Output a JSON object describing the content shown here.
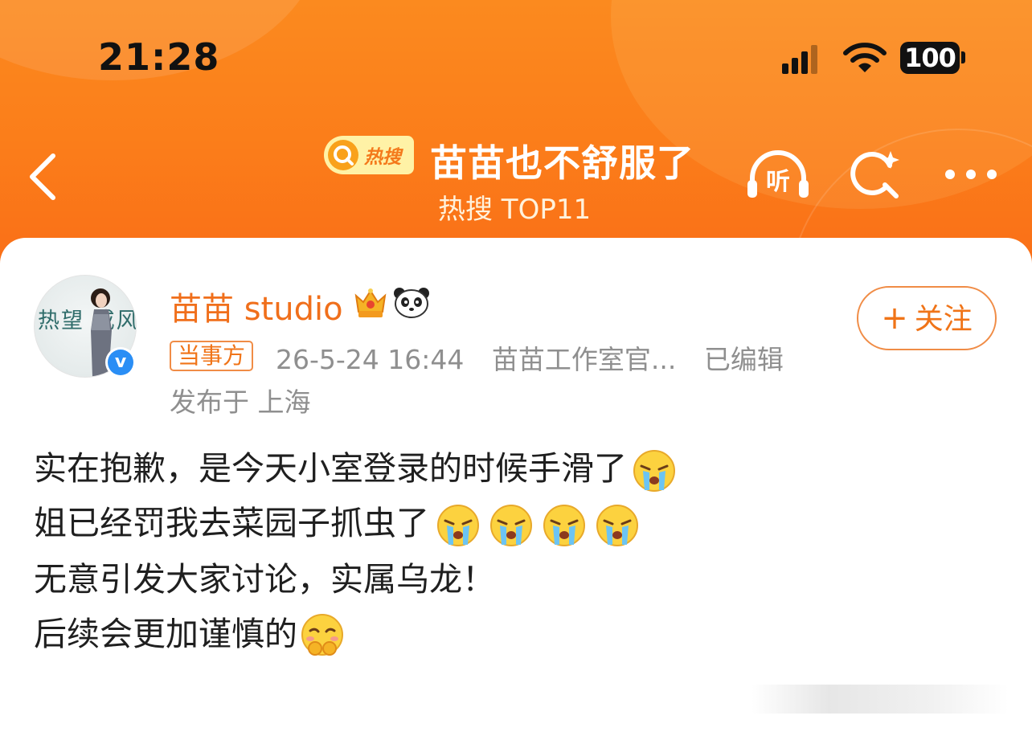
{
  "status_bar": {
    "time": "21:28",
    "battery": "100",
    "icons": [
      "signal-icon",
      "wifi-icon",
      "battery-icon"
    ]
  },
  "header": {
    "back_icon": "chevron-left-icon",
    "badge_label": "热搜",
    "title": "苗苗也不舒服了",
    "subtitle": "热搜 TOP11",
    "listen_label": "听",
    "actions": [
      "listen-icon",
      "search-icon",
      "more-icon"
    ]
  },
  "post": {
    "avatar_text": "热望 戒风",
    "author": "苗苗 studio",
    "follow_label": "关注",
    "party_tag": "当事方",
    "date": "26-5-24 16:44",
    "source": "苗苗工作室官...",
    "edited": "已编辑",
    "location": "发布于 上海",
    "lines": [
      "实在抱歉，是今天小室登录的时候手滑了",
      "姐已经罚我去菜园子抓虫了",
      "无意引发大家讨论，实属乌龙！",
      "后续会更加谨慎的"
    ]
  },
  "colors": {
    "header_orange": "#fb7d1a",
    "accent": "#f07418",
    "verified_blue": "#2a8ef5",
    "meta_gray": "#8f8f8f"
  }
}
